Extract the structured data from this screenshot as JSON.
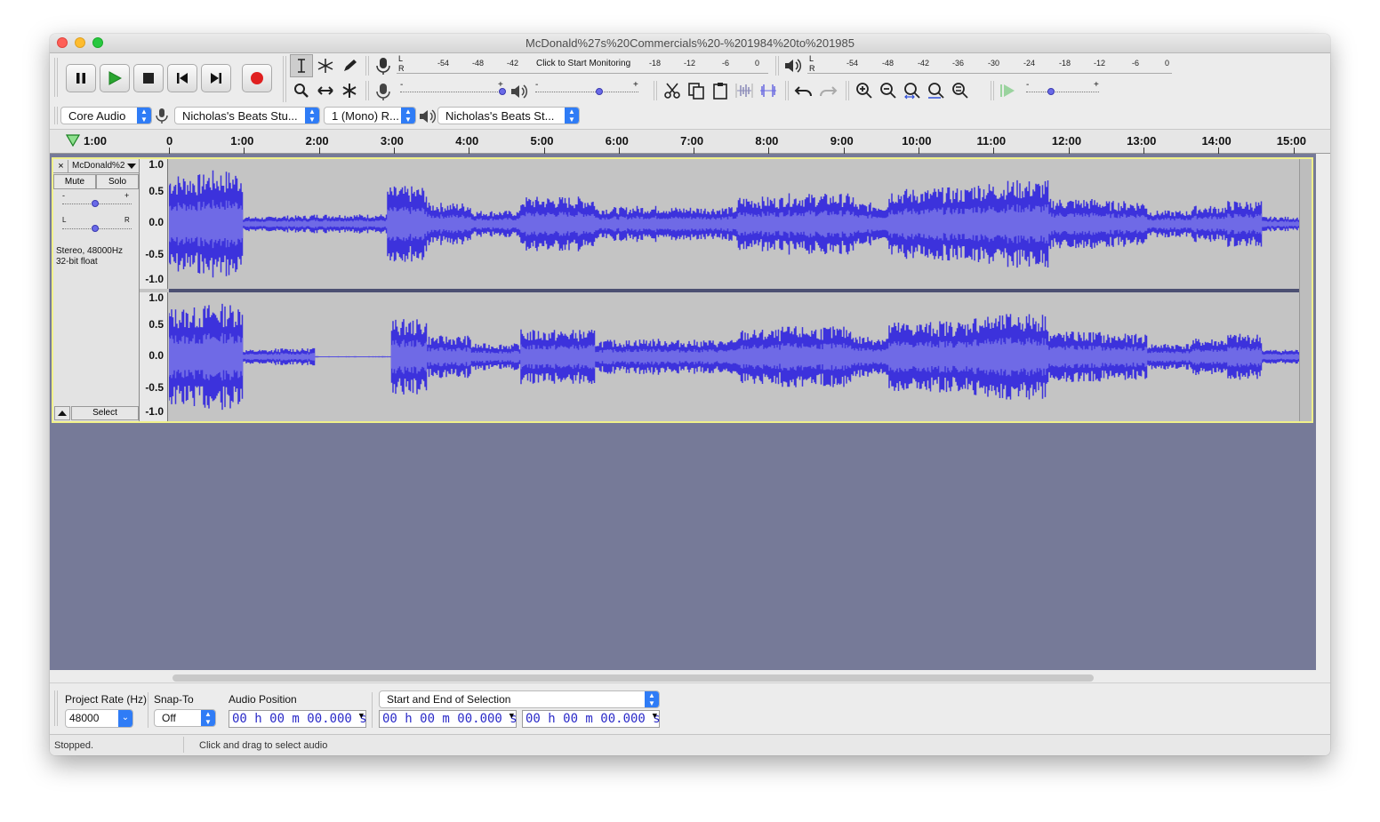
{
  "window": {
    "title": "McDonald%27s%20Commercials%20-%201984%20to%201985"
  },
  "meters": {
    "record_scale": [
      "-54",
      "-48",
      "-42",
      "-18",
      "-12",
      "-6",
      "0"
    ],
    "record_hint": "Click to Start Monitoring",
    "playback_scale": [
      "-54",
      "-48",
      "-42",
      "-36",
      "-30",
      "-24",
      "-18",
      "-12",
      "-6",
      "0"
    ],
    "lr": [
      "L",
      "R"
    ]
  },
  "devices": {
    "host": "Core Audio",
    "recording_device": "Nicholas's Beats Stu...",
    "channels": "1 (Mono) R...",
    "playback_device": "Nicholas's Beats St..."
  },
  "ruler": {
    "pre_label": "1:00",
    "labels": [
      "0",
      "1:00",
      "2:00",
      "3:00",
      "4:00",
      "5:00",
      "6:00",
      "7:00",
      "8:00",
      "9:00",
      "10:00",
      "11:00",
      "12:00",
      "13:00",
      "14:00",
      "15:00"
    ]
  },
  "track": {
    "name": "McDonald%2",
    "mute_label": "Mute",
    "solo_label": "Solo",
    "info_line1": "Stereo, 48000Hz",
    "info_line2": "32-bit float",
    "select_label": "Select",
    "gain_labels": [
      "-",
      "+"
    ],
    "pan_labels": [
      "L",
      "R"
    ],
    "gain_value": 0.5,
    "pan_value": 0.5,
    "scale": [
      "1.0",
      "0.5",
      "0.0",
      "-0.5",
      "-1.0"
    ]
  },
  "selection_toolbar": {
    "project_rate_label": "Project Rate (Hz)",
    "project_rate_value": "48000",
    "snap_label": "Snap-To",
    "snap_value": "Off",
    "audio_position_label": "Audio Position",
    "audio_position_value": "00 h 00 m 00.000 s",
    "selection_mode": "Start and End of Selection",
    "selection_start": "00 h 00 m 00.000 s",
    "selection_end": "00 h 00 m 00.000 s"
  },
  "status": {
    "state": "Stopped.",
    "hint": "Click and drag to select audio"
  },
  "colors": {
    "waveform": "#3c32dc",
    "waveform_rms": "#6f6ae6",
    "track_bg": "#c4c4c4",
    "empty_area": "#767a98",
    "record_button": "#e02020",
    "play_button": "#2aa530",
    "selection_border": "#f0f08a"
  }
}
